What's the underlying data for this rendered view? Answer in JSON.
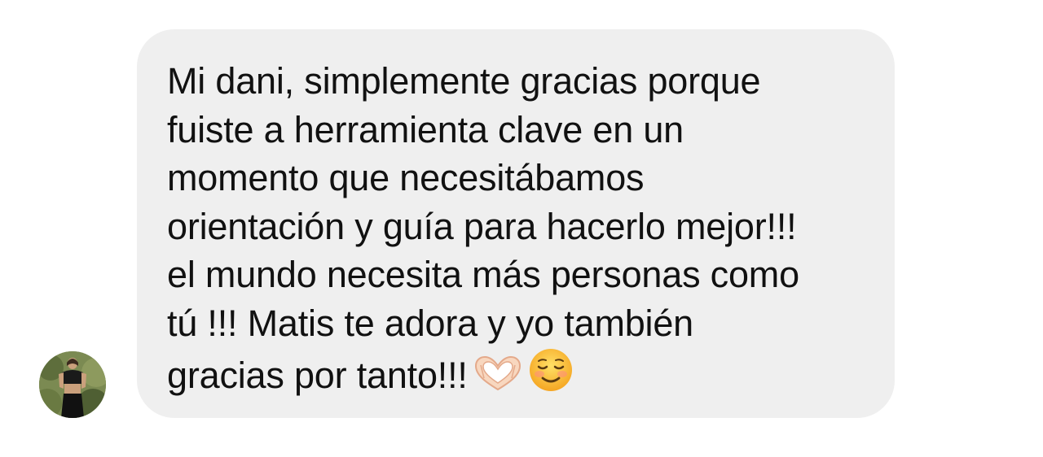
{
  "conversation": {
    "sender": {
      "avatar_icon": "profile-photo"
    },
    "message": {
      "text": "Mi dani, simplemente gracias porque\nfuiste a herramienta clave en un\nmomento que necesitábamos\norientación y guía para hacerlo mejor!!!\nel mundo necesita más personas como\ntú !!! Matis te adora y yo también\ngracias por tanto!!!",
      "emojis": [
        "heart-hands-icon",
        "smiling-face-icon"
      ]
    }
  },
  "colors": {
    "bubble_background": "#efefef",
    "text": "#111111",
    "page_background": "#ffffff"
  }
}
